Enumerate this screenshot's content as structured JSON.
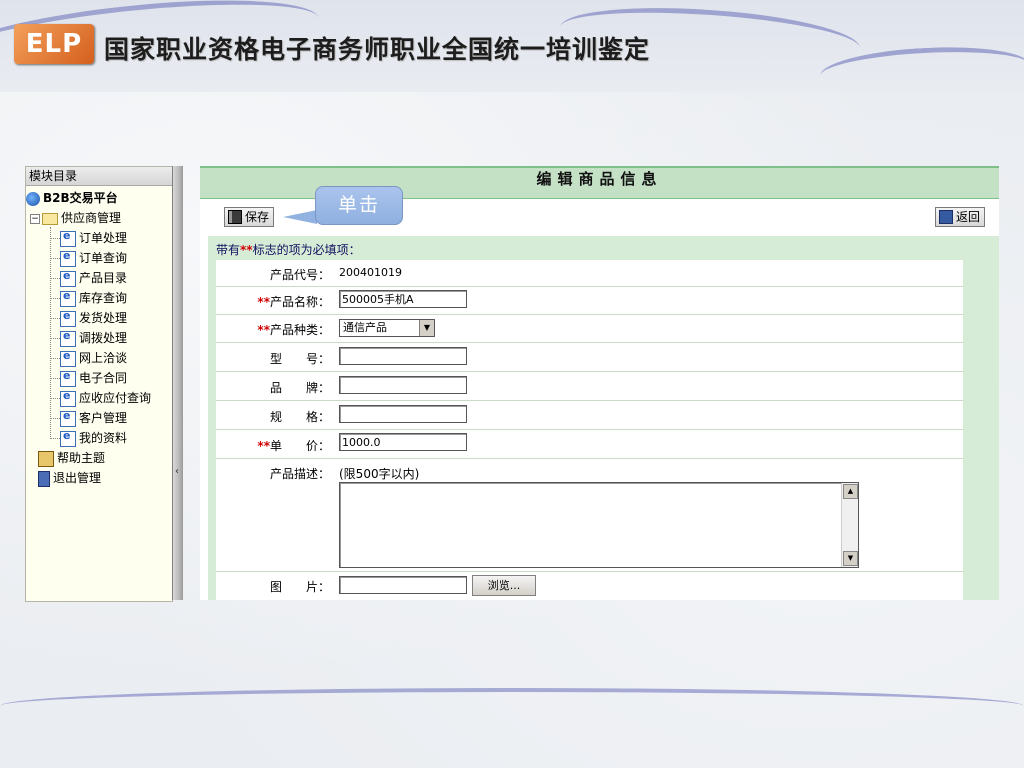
{
  "slide": {
    "logo_text": "ELP",
    "title": "国家职业资格电子商务师职业全国统一培训鉴定"
  },
  "tree": {
    "header": "模块目录",
    "root": "B2B交易平台",
    "group": "供应商管理",
    "items": [
      "订单处理",
      "订单查询",
      "产品目录",
      "库存查询",
      "发货处理",
      "调拨处理",
      "网上洽谈",
      "电子合同",
      "应收应付查询",
      "客户管理",
      "我的资料"
    ],
    "help": "帮助主题",
    "exit": "退出管理"
  },
  "main": {
    "title": "编辑商品信息",
    "save_label": "保存",
    "back_label": "返回",
    "callout": "单击",
    "note_prefix": "带有",
    "note_stars": "**",
    "note_suffix": "标志的项为必填项："
  },
  "form": {
    "req_mark": "**",
    "code_label": "产品代号：",
    "code_value": "200401019",
    "name_label": "产品名称：",
    "name_value": "500005手机A",
    "type_label": "产品种类：",
    "type_value": "通信产品",
    "model_label": "型　　号：",
    "model_value": "",
    "brand_label": "品　　牌：",
    "brand_value": "",
    "spec_label": "规　　格：",
    "spec_value": "",
    "price_label": "单　　价：",
    "price_value": "1000.0",
    "desc_label": "产品描述：",
    "desc_hint": "(限500字以内)",
    "image_label": "图　　片：",
    "browse_label": "浏览..."
  },
  "colors": {
    "title_band": "#c4e1c6",
    "form_band": "#d7ecd6",
    "required": "#d00000",
    "callout": "#92b2e1"
  }
}
